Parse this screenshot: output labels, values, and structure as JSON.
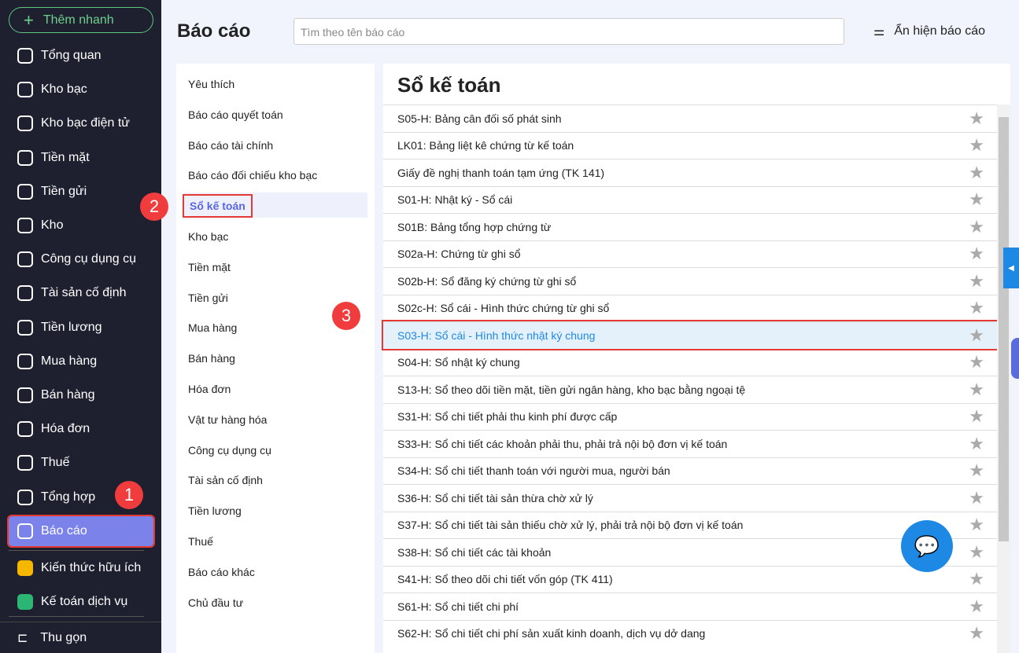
{
  "sidebar": {
    "quick_add": "Thêm nhanh",
    "items": [
      "Tổng quan",
      "Kho bạc",
      "Kho bạc điện tử",
      "Tiền mặt",
      "Tiền gửi",
      "Kho",
      "Công cụ dụng cụ",
      "Tài sản cố định",
      "Tiền lương",
      "Mua hàng",
      "Bán hàng",
      "Hóa đơn",
      "Thuế",
      "Tổng hợp",
      "Báo cáo"
    ],
    "extra": [
      "Kiến thức hữu ích",
      "Kế toán dịch vụ"
    ],
    "collapse": "Thu gọn"
  },
  "header": {
    "title": "Báo cáo",
    "search_placeholder": "Tìm theo tên báo cáo",
    "toggle": "Ẩn hiện báo cáo"
  },
  "categories": [
    "Yêu thích",
    "Báo cáo quyết toán",
    "Báo cáo tài chính",
    "Báo cáo đối chiếu kho bạc",
    "Sổ kế toán",
    "Kho bạc",
    "Tiền mặt",
    "Tiền gửi",
    "Mua hàng",
    "Bán hàng",
    "Hóa đơn",
    "Vật tư hàng hóa",
    "Công cụ dụng cụ",
    "Tài sản cố định",
    "Tiền lương",
    "Thuế",
    "Báo cáo khác",
    "Chủ đầu tư"
  ],
  "panel": {
    "title": "Sổ kế toán",
    "reports": [
      "S05-H: Bảng cân đối số phát sinh",
      "LK01: Bảng liệt kê chứng từ kế toán",
      "Giấy đề nghị thanh toán tạm ứng (TK 141)",
      "S01-H: Nhật ký - Sổ cái",
      "S01B: Bảng tổng hợp chứng từ",
      "S02a-H: Chứng từ ghi sổ",
      "S02b-H: Sổ đăng ký chứng từ ghi sổ",
      "S02c-H: Sổ cái - Hình thức chứng từ ghi sổ",
      "S03-H: Sổ cái - Hình thức nhật ký chung",
      "S04-H: Sổ nhật ký chung",
      "S13-H: Sổ theo dõi tiền mặt, tiền gửi ngân hàng, kho bạc bằng ngoại tệ",
      "S31-H: Sổ chi tiết phải thu kinh phí được cấp",
      "S33-H: Sổ chi tiết các khoản phải thu, phải trả nội bộ đơn vị kế toán",
      "S34-H: Sổ chi tiết thanh toán với người mua, người bán",
      "S36-H: Sổ chi tiết tài sản thừa chờ xử lý",
      "S37-H: Sổ chi tiết tài sản thiếu chờ xử lý, phải trả nội bộ đơn vị kế toán",
      "S38-H: Sổ chi tiết các tài khoản",
      "S41-H: Sổ theo dõi chi tiết vốn góp (TK 411)",
      "S61-H: Sổ chi tiết chi phí",
      "S62-H: Sổ chi tiết chi phí sản xuất kinh doanh, dịch vụ dở dang"
    ]
  },
  "badges": [
    "1",
    "2",
    "3"
  ]
}
